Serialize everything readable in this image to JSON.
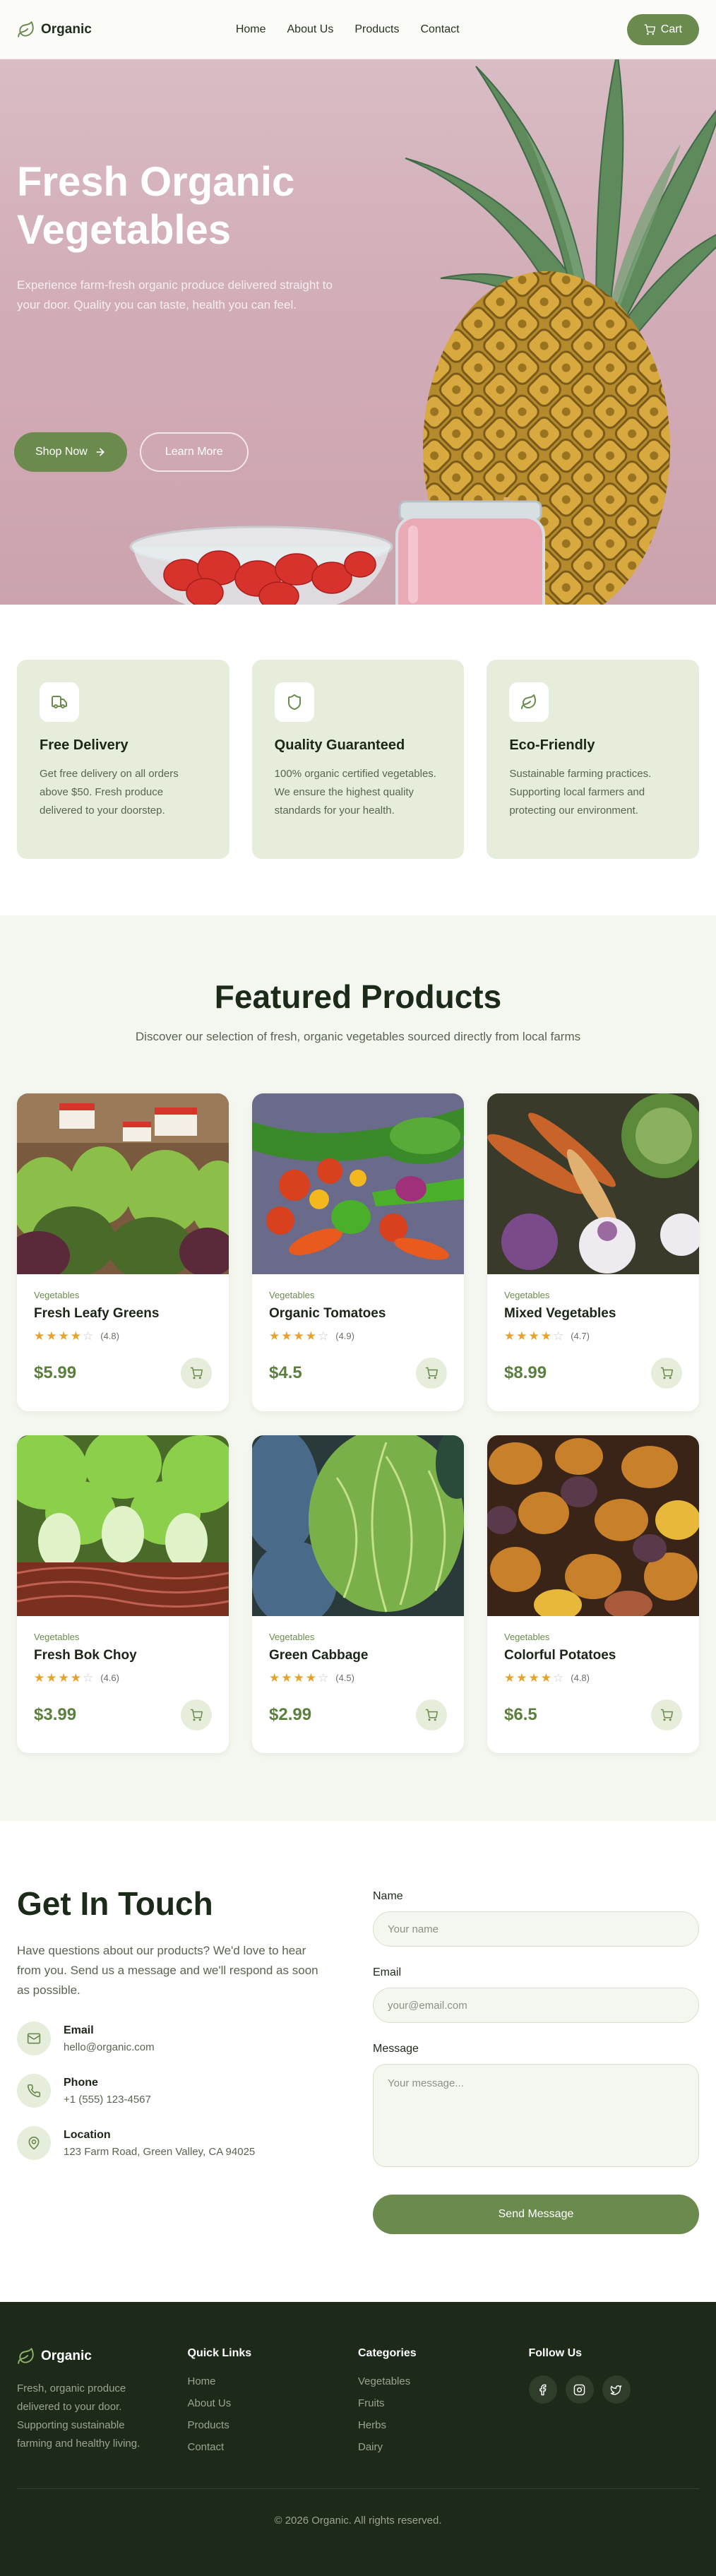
{
  "colors": {
    "brand": "#6b8a4e",
    "brand_light": "#e6edda",
    "dark": "#1d2a1a",
    "star": "#e8a12a"
  },
  "nav": {
    "brand": "Organic",
    "links": [
      "Home",
      "About Us",
      "Products",
      "Contact"
    ],
    "cart_label": "Cart"
  },
  "hero": {
    "title": "Fresh Organic Vegetables",
    "subtitle": "Experience farm-fresh organic produce delivered straight to your door. Quality you can taste, health you can feel.",
    "primary_btn": "Shop Now",
    "secondary_btn": "Learn More"
  },
  "features": [
    {
      "icon": "truck-icon",
      "title": "Free Delivery",
      "desc": "Get free delivery on all orders above $50. Fresh produce delivered to your doorstep."
    },
    {
      "icon": "shield-icon",
      "title": "Quality Guaranteed",
      "desc": "100% organic certified vegetables. We ensure the highest quality standards for your health."
    },
    {
      "icon": "leaf-icon",
      "title": "Eco-Friendly",
      "desc": "Sustainable farming practices. Supporting local farmers and protecting our environment."
    }
  ],
  "products": {
    "title": "Featured Products",
    "subtitle": "Discover our selection of fresh, organic vegetables sourced directly from local farms",
    "items": [
      {
        "category": "Vegetables",
        "name": "Fresh Leafy Greens",
        "rating": 4,
        "rating_label": "(4.8)",
        "price": "$5.99",
        "image": "leafy-greens-image"
      },
      {
        "category": "Vegetables",
        "name": "Organic Tomatoes",
        "rating": 4,
        "rating_label": "(4.9)",
        "price": "$4.5",
        "image": "tomatoes-image"
      },
      {
        "category": "Vegetables",
        "name": "Mixed Vegetables",
        "rating": 4,
        "rating_label": "(4.7)",
        "price": "$8.99",
        "image": "mixed-vegetables-image"
      },
      {
        "category": "Vegetables",
        "name": "Fresh Bok Choy",
        "rating": 4,
        "rating_label": "(4.6)",
        "price": "$3.99",
        "image": "bok-choy-image"
      },
      {
        "category": "Vegetables",
        "name": "Green Cabbage",
        "rating": 4,
        "rating_label": "(4.5)",
        "price": "$2.99",
        "image": "cabbage-image"
      },
      {
        "category": "Vegetables",
        "name": "Colorful Potatoes",
        "rating": 4,
        "rating_label": "(4.8)",
        "price": "$6.5",
        "image": "potatoes-image"
      }
    ]
  },
  "contact": {
    "title": "Get In Touch",
    "subtitle": "Have questions about our products? We'd love to hear from you. Send us a message and we'll respond as soon as possible.",
    "items": [
      {
        "icon": "mail-icon",
        "label": "Email",
        "value": "hello@organic.com"
      },
      {
        "icon": "phone-icon",
        "label": "Phone",
        "value": "+1 (555) 123-4567"
      },
      {
        "icon": "map-pin-icon",
        "label": "Location",
        "value": "123 Farm Road, Green Valley, CA 94025"
      }
    ],
    "form": {
      "name_label": "Name",
      "name_placeholder": "Your name",
      "email_label": "Email",
      "email_placeholder": "your@email.com",
      "message_label": "Message",
      "message_placeholder": "Your message...",
      "submit": "Send Message"
    }
  },
  "footer": {
    "brand": "Organic",
    "about": "Fresh, organic produce delivered to your door. Supporting sustainable farming and healthy living.",
    "quick_links": {
      "title": "Quick Links",
      "items": [
        "Home",
        "About Us",
        "Products",
        "Contact"
      ]
    },
    "categories": {
      "title": "Categories",
      "items": [
        "Vegetables",
        "Fruits",
        "Herbs",
        "Dairy"
      ]
    },
    "follow": {
      "title": "Follow Us",
      "icons": [
        "facebook-icon",
        "instagram-icon",
        "twitter-icon"
      ]
    },
    "copyright": "© 2026 Organic. All rights reserved."
  }
}
